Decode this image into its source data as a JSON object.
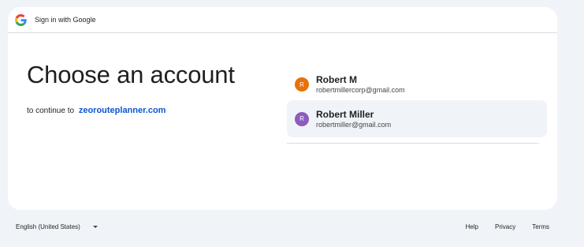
{
  "header": {
    "title": "Sign in with Google"
  },
  "main": {
    "heading": "Choose an account",
    "continue_prefix": "to continue to",
    "site_link": "zeorouteplanner.com"
  },
  "accounts": [
    {
      "initial": "R",
      "name": "Robert M",
      "email": "robertmillercorp@gmail.com",
      "avatar_color": "#e8710a",
      "selected": false
    },
    {
      "initial": "R",
      "name": "Robert Miller",
      "email": "robertmiller@gmail.com",
      "avatar_color": "#8e5bbf",
      "selected": true
    }
  ],
  "footer": {
    "language": "English (United States)",
    "links": [
      "Help",
      "Privacy",
      "Terms"
    ]
  },
  "colors": {
    "page_bg": "#f0f4f9",
    "link_blue": "#0b57d0"
  }
}
